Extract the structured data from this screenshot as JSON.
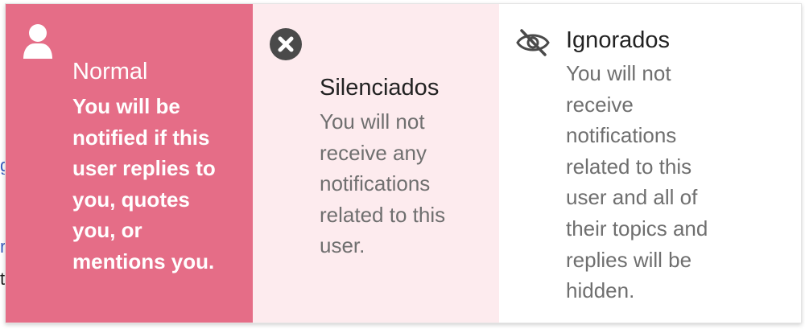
{
  "notification_menu": {
    "options": [
      {
        "key": "normal",
        "icon": "user-icon",
        "title": "Normal",
        "description": "You will be\nnotified if this\nuser replies to\nyou, quotes\nyou, or\nmentions you.",
        "selected": true
      },
      {
        "key": "silenced",
        "icon": "times-circle-icon",
        "title": "Silenciados",
        "description": "You will not\nreceive any\nnotifications\nrelated to this\nuser.",
        "selected": false
      },
      {
        "key": "ignored",
        "icon": "eye-slash-icon",
        "title": "Ignorados",
        "description": "You will not\nreceive\nnotifications\nrelated to this\nuser and all of\ntheir topics and\nreplies will be\nhidden.",
        "selected": false
      }
    ]
  },
  "colors": {
    "selected_bg": "#e56d87",
    "hover_bg": "#fdebee",
    "title_text": "#222222",
    "description_text": "#6f6f6f",
    "icon_dark": "#4a4a4a"
  }
}
